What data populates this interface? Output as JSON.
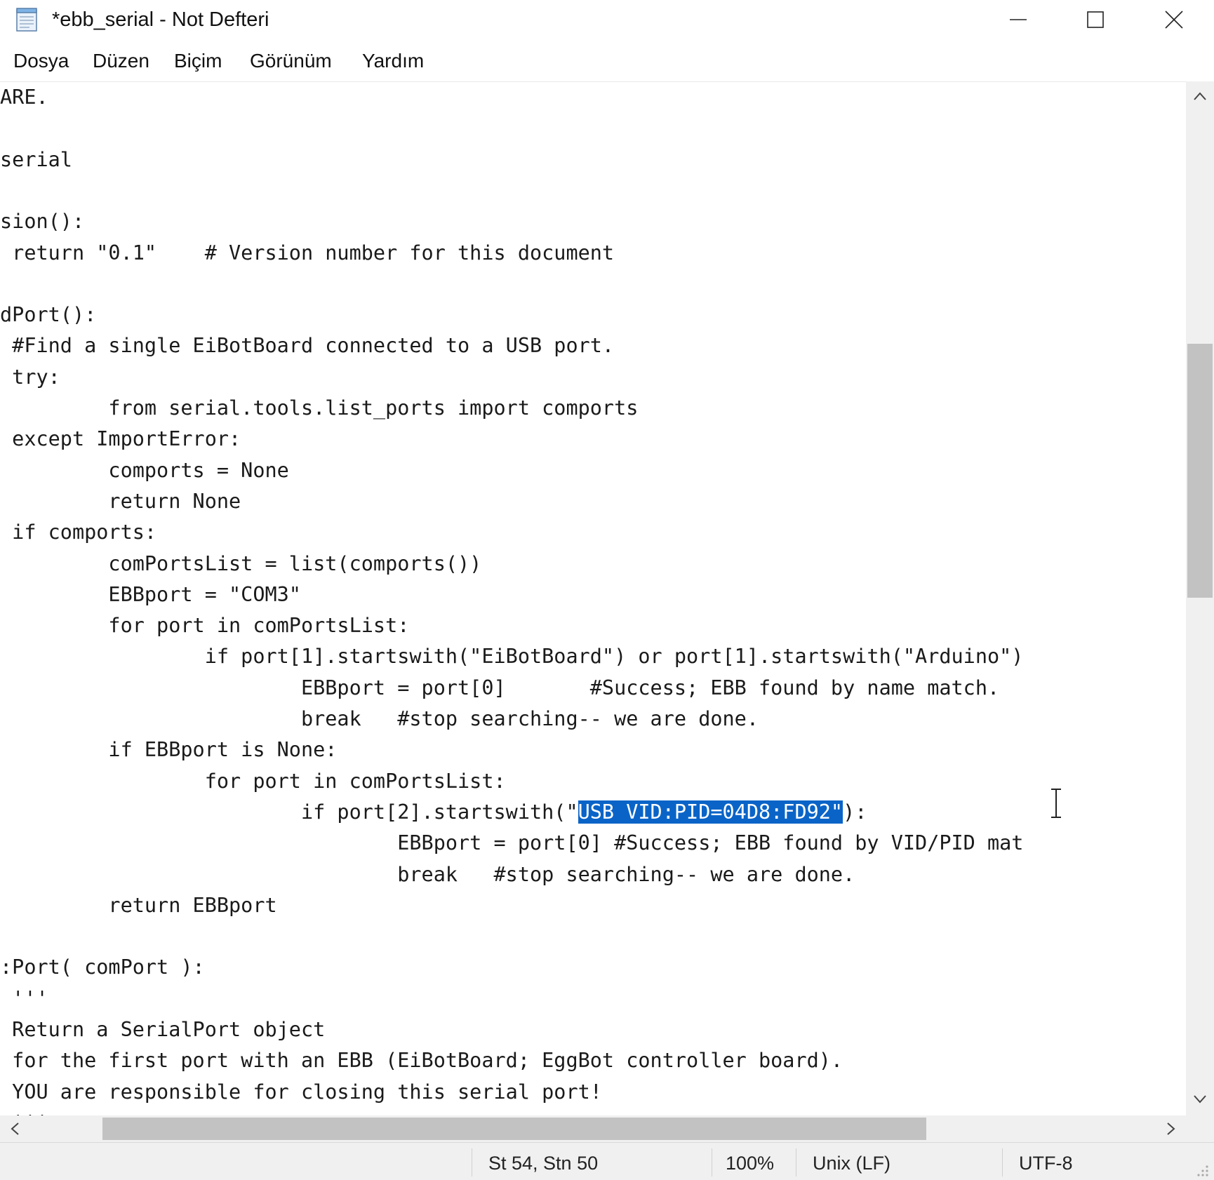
{
  "window": {
    "title": "*ebb_serial - Not Defteri",
    "app_icon": "notepad-icon",
    "controls": {
      "minimize": "minimize-icon",
      "maximize": "maximize-icon",
      "close": "close-icon"
    }
  },
  "menu": {
    "items": [
      "Dosya",
      "Düzen",
      "Biçim",
      "Görünüm",
      "Yardım"
    ]
  },
  "editor": {
    "lines": [
      "ARE.",
      "",
      "serial",
      "",
      "sion():",
      " return \"0.1\"    # Version number for this document",
      "",
      "dPort():",
      " #Find a single EiBotBoard connected to a USB port.",
      " try:",
      "         from serial.tools.list_ports import comports",
      " except ImportError:",
      "         comports = None",
      "         return None",
      " if comports:",
      "         comPortsList = list(comports())",
      "         EBBport = \"COM3\"",
      "         for port in comPortsList:",
      "                 if port[1].startswith(\"EiBotBoard\") or port[1].startswith(\"Arduino\")",
      "                         EBBport = port[0]       #Success; EBB found by name match.",
      "                         break   #stop searching-- we are done.",
      "         if EBBport is None:",
      "                 for port in comPortsList:",
      "                         if port[2].startswith(\"USB VID:PID=04D8:FD92\"):",
      "                                 EBBport = port[0] #Success; EBB found by VID/PID mat",
      "                                 break   #stop searching-- we are done.",
      "         return EBBport",
      "",
      ":Port( comPort ):",
      " '''",
      " Return a SerialPort object",
      " for the first port with an EBB (EiBotBoard; EggBot controller board).",
      " YOU are responsible for closing this serial port!",
      " '''"
    ],
    "selection": {
      "line_index": 23,
      "before": "                         if port[2].startswith(\"",
      "selected": "USB VID:PID=04D8:FD92\"",
      "after": "):"
    },
    "selection_color": "#0a64c8"
  },
  "status": {
    "position": "St 54, Stn 50",
    "zoom": "100%",
    "line_ending": "Unix (LF)",
    "encoding": "UTF-8"
  }
}
